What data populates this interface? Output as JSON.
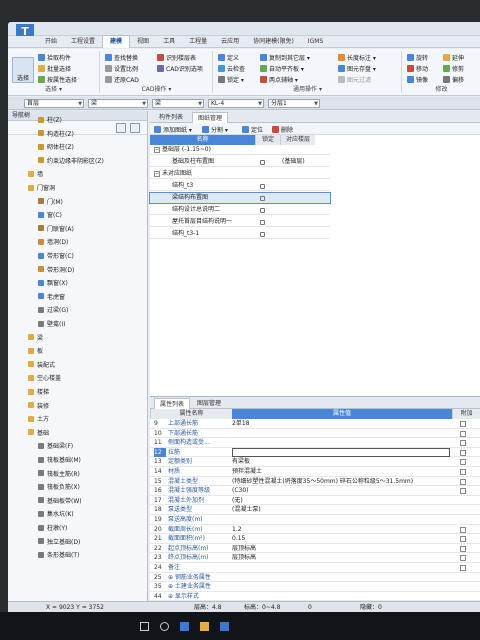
{
  "menu": {
    "tabs": [
      "开始",
      "工程设置",
      "建模",
      "视图",
      "工具",
      "工程量",
      "云应用",
      "协同建模(限免)",
      "IGMS"
    ],
    "active": "建模"
  },
  "ribbon": {
    "select_label": "选择",
    "group1": {
      "items": [
        "拾取构件",
        "批量选择",
        "按属性选择"
      ],
      "title": "选择 ▾"
    },
    "group2": {
      "items": [
        "查找替换",
        "设置比例",
        "还原CAD",
        "识别楼层表",
        "CAD识别选项"
      ],
      "title": "CAD操作 ▾"
    },
    "group3": {
      "items": [
        "定义",
        "云检查",
        "锁定 ▾",
        "复制到其它层 ▾",
        "自动平齐板 ▾",
        "两点辅轴 ▾",
        "长度标注 ▾",
        "图元存盘 ▾",
        "图元过滤"
      ],
      "title": "通用操作 ▾"
    },
    "group4": {
      "items": [
        "旋转",
        "移动",
        "镜像",
        "延伸",
        "修剪",
        "偏移"
      ],
      "title": "修改"
    }
  },
  "propbar": {
    "floor": "首层",
    "category": "梁",
    "type": "梁",
    "component": "KL-4",
    "layer": "分层1"
  },
  "nav": {
    "title": "导航树",
    "items": [
      {
        "label": "柱(Z)",
        "level": 2,
        "color": "#c89a2a"
      },
      {
        "label": "构造柱(Z)",
        "level": 2,
        "color": "#c89a2a"
      },
      {
        "label": "砌体柱(Z)",
        "level": 2,
        "color": "#c89a2a"
      },
      {
        "label": "约束边缘非阴影区(Z)",
        "level": 2,
        "color": "#c89a2a"
      },
      {
        "label": "墙",
        "level": 1,
        "color": "#e0a94a"
      },
      {
        "label": "门窗洞",
        "level": 1,
        "color": "#e0a94a"
      },
      {
        "label": "门(M)",
        "level": 2,
        "color": "#a97a3c"
      },
      {
        "label": "窗(C)",
        "level": 2,
        "color": "#4a86d8"
      },
      {
        "label": "门联窗(A)",
        "level": 2,
        "color": "#a97a3c"
      },
      {
        "label": "墙洞(D)",
        "level": 2,
        "color": "#d08a3a"
      },
      {
        "label": "带形窗(C)",
        "level": 2,
        "color": "#4a86d8"
      },
      {
        "label": "带形洞(D)",
        "level": 2,
        "color": "#d08a3a"
      },
      {
        "label": "飘窗(X)",
        "level": 2,
        "color": "#4a86d8"
      },
      {
        "label": "老虎窗",
        "level": 2,
        "color": "#4a86d8"
      },
      {
        "label": "过梁(G)",
        "level": 2,
        "color": "#7a7a7a"
      },
      {
        "label": "壁龛(I)",
        "level": 2,
        "color": "#7a7a7a"
      },
      {
        "label": "梁",
        "level": 1,
        "color": "#e0a94a"
      },
      {
        "label": "板",
        "level": 1,
        "color": "#e0a94a"
      },
      {
        "label": "装配式",
        "level": 1,
        "color": "#e0a94a"
      },
      {
        "label": "空心楼盖",
        "level": 1,
        "color": "#e0a94a"
      },
      {
        "label": "楼梯",
        "level": 1,
        "color": "#e0a94a"
      },
      {
        "label": "装修",
        "level": 1,
        "color": "#e0a94a"
      },
      {
        "label": "土方",
        "level": 1,
        "color": "#e0a94a"
      },
      {
        "label": "基础",
        "level": 1,
        "color": "#e0a94a"
      },
      {
        "label": "基础梁(F)",
        "level": 2,
        "color": "#7a7a7a"
      },
      {
        "label": "筏板基础(M)",
        "level": 2,
        "color": "#7a7a7a"
      },
      {
        "label": "筏板主筋(R)",
        "level": 2,
        "color": "#7a7a7a"
      },
      {
        "label": "筏板负筋(X)",
        "level": 2,
        "color": "#7a7a7a"
      },
      {
        "label": "基础板带(W)",
        "level": 2,
        "color": "#7a7a7a"
      },
      {
        "label": "集水坑(K)",
        "level": 2,
        "color": "#7a7a7a"
      },
      {
        "label": "柱墩(Y)",
        "level": 2,
        "color": "#7a7a7a"
      },
      {
        "label": "独立基础(D)",
        "level": 2,
        "color": "#7a7a7a"
      },
      {
        "label": "条形基础(T)",
        "level": 2,
        "color": "#7a7a7a"
      }
    ]
  },
  "drawing_panel": {
    "tabs": [
      "构件列表",
      "图纸管理"
    ],
    "active_tab": "图纸管理",
    "tools": [
      "添加图纸 ▾",
      "分割 ▾",
      "定位",
      "删除"
    ],
    "columns": [
      "名称",
      "锁定",
      "对应楼层"
    ],
    "rows": [
      {
        "name": "基础层 (-1.15~0)",
        "floor": "",
        "group": true
      },
      {
        "name": "基础及柱布置图",
        "floor": "(基础层)",
        "group": false
      },
      {
        "name": "未对应图纸",
        "floor": "",
        "group": true
      },
      {
        "name": "结构_t3",
        "floor": "",
        "group": false
      },
      {
        "name": "梁结构布置图",
        "floor": "",
        "group": false,
        "selected": true
      },
      {
        "name": "结构设计总说明二",
        "floor": "",
        "group": false
      },
      {
        "name": "屋托首层目结构说明一",
        "floor": "",
        "group": false
      },
      {
        "name": "结构_t3-1",
        "floor": "",
        "group": false
      }
    ]
  },
  "properties": {
    "tabs": [
      "属性列表",
      "图层管理"
    ],
    "active_tab": "属性列表",
    "columns": [
      "属性名称",
      "属性值",
      "附加"
    ],
    "rows": [
      {
        "no": "9",
        "name": "上部通长筋",
        "value": "2单18",
        "cb": true
      },
      {
        "no": "10",
        "name": "下部通长筋",
        "value": "",
        "cb": true
      },
      {
        "no": "11",
        "name": "侧面构造或受...",
        "value": "",
        "cb": true
      },
      {
        "no": "12",
        "name": "拉筋",
        "value": "",
        "cb": true,
        "hl": true
      },
      {
        "no": "13",
        "name": "定额类别",
        "value": "有梁板",
        "cb": true
      },
      {
        "no": "14",
        "name": "材质",
        "value": "预拌混凝土",
        "cb": true
      },
      {
        "no": "15",
        "name": "混凝土类型",
        "value": "(特细砂塑性混凝土(坍落度35～50mm) 碎石公称粒级5～31.5mm)",
        "cb": true
      },
      {
        "no": "16",
        "name": "混凝土强度等级",
        "value": "(C30)",
        "cb": true
      },
      {
        "no": "17",
        "name": "混凝土外加剂",
        "value": "(无)",
        "cb": false
      },
      {
        "no": "18",
        "name": "泵送类型",
        "value": "(混凝土泵)",
        "cb": false
      },
      {
        "no": "19",
        "name": "泵送高度(m)",
        "value": "",
        "cb": false
      },
      {
        "no": "20",
        "name": "截面周长(m)",
        "value": "1.2",
        "cb": true
      },
      {
        "no": "21",
        "name": "截面面积(m²)",
        "value": "0.15",
        "cb": true
      },
      {
        "no": "22",
        "name": "起点顶标高(m)",
        "value": "层顶标高",
        "cb": true
      },
      {
        "no": "23",
        "name": "终点顶标高(m)",
        "value": "层顶标高",
        "cb": true
      },
      {
        "no": "24",
        "name": "备注",
        "value": "",
        "cb": true
      },
      {
        "no": "25",
        "name": "⊕ 钢筋业务属性",
        "value": "",
        "cb": false
      },
      {
        "no": "35",
        "name": "⊕ 土建业务属性",
        "value": "",
        "cb": false
      },
      {
        "no": "44",
        "name": "⊕ 显示样式",
        "value": "",
        "cb": false
      }
    ]
  },
  "status": {
    "coords": "X = 9023 Y = 3752",
    "floor_height": "层高：4.8",
    "elevation": "标高：0~4.8",
    "value": "0",
    "hidden": "隐藏：0"
  }
}
